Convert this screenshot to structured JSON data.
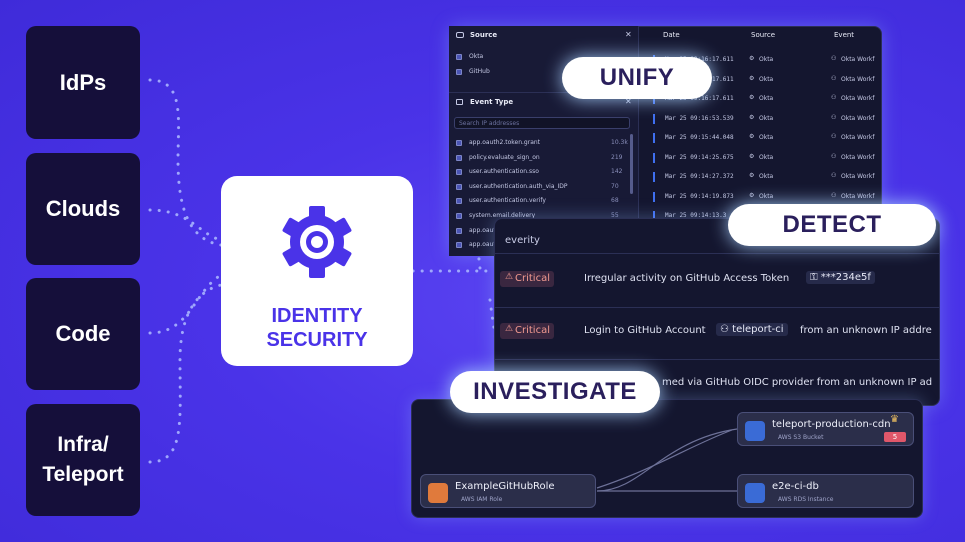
{
  "sources": [
    "IdPs",
    "Clouds",
    "Code",
    "Infra/\nTeleport"
  ],
  "hub": {
    "label": "IDENTITY\nSECURITY",
    "icon": "gear-icon",
    "color": "#4a33e8"
  },
  "stages": {
    "unify": "UNIFY",
    "detect": "DETECT",
    "investigate": "INVESTIGATE"
  },
  "unify_panel": {
    "source_header": "Source",
    "sources": [
      "Okta",
      "GitHub"
    ],
    "event_type_header": "Event Type",
    "search_placeholder": "Search IP addresses",
    "event_types": [
      {
        "name": "app.oauth2.token.grant",
        "count": "10.3k"
      },
      {
        "name": "policy.evaluate_sign_on",
        "count": "219"
      },
      {
        "name": "user.authentication.sso",
        "count": "142"
      },
      {
        "name": "user.authentication.auth_via_IDP",
        "count": "70"
      },
      {
        "name": "user.authentication.verify",
        "count": "68"
      },
      {
        "name": "system.email.delivery",
        "count": "55"
      },
      {
        "name": "app.oauth",
        "count": ""
      },
      {
        "name": "app.oauth",
        "count": ""
      },
      {
        "name": "app.oauth",
        "count": ""
      }
    ],
    "table_headers": [
      "Date",
      "Source",
      "Event"
    ],
    "rows": [
      {
        "date": "Mar 25 09:16:17.611",
        "source": "Okta",
        "event": "Okta Workf"
      },
      {
        "date": "Mar 25 09:16:17.611",
        "source": "Okta",
        "event": "Okta Workf"
      },
      {
        "date": "Mar 25 09:16:17.611",
        "source": "Okta",
        "event": "Okta Workf"
      },
      {
        "date": "Mar 25 09:16:53.539",
        "source": "Okta",
        "event": "Okta Workf"
      },
      {
        "date": "Mar 25 09:15:44.048",
        "source": "Okta",
        "event": "Okta Workf"
      },
      {
        "date": "Mar 25 09:14:25.675",
        "source": "Okta",
        "event": "Okta Workf"
      },
      {
        "date": "Mar 25 09:14:27.372",
        "source": "Okta",
        "event": "Okta Workf"
      },
      {
        "date": "Mar 25 09:14:19.873",
        "source": "Okta",
        "event": "Okta Workf"
      },
      {
        "date": "Mar 25 09:14:13.3",
        "source": "",
        "event": ""
      }
    ]
  },
  "detect_panel": {
    "header": "everity",
    "alerts": [
      {
        "severity": "Critical",
        "text": "Irregular activity on GitHub Access Token",
        "chip": "***234e5f",
        "suffix": ""
      },
      {
        "severity": "Critical",
        "text": "Login to GitHub Account",
        "chip": "teleport-ci",
        "suffix": "from an unknown IP addre"
      },
      {
        "severity": "",
        "text": "med via GitHub OIDC provider from an unknown IP ad",
        "chip": "",
        "suffix": ""
      }
    ]
  },
  "investigate_panel": {
    "nodes": [
      {
        "title": "ExampleGitHubRole",
        "subtitle": "AWS IAM Role"
      },
      {
        "title": "teleport-production-cdn",
        "subtitle": "AWS S3 Bucket",
        "badge": "5"
      },
      {
        "title": "e2e-ci-db",
        "subtitle": "AWS RDS Instance"
      }
    ]
  },
  "colors": {
    "background": "#4a33e8",
    "panel": "#14162f",
    "critical": "#f29a90",
    "accent": "#3f6ff0"
  }
}
